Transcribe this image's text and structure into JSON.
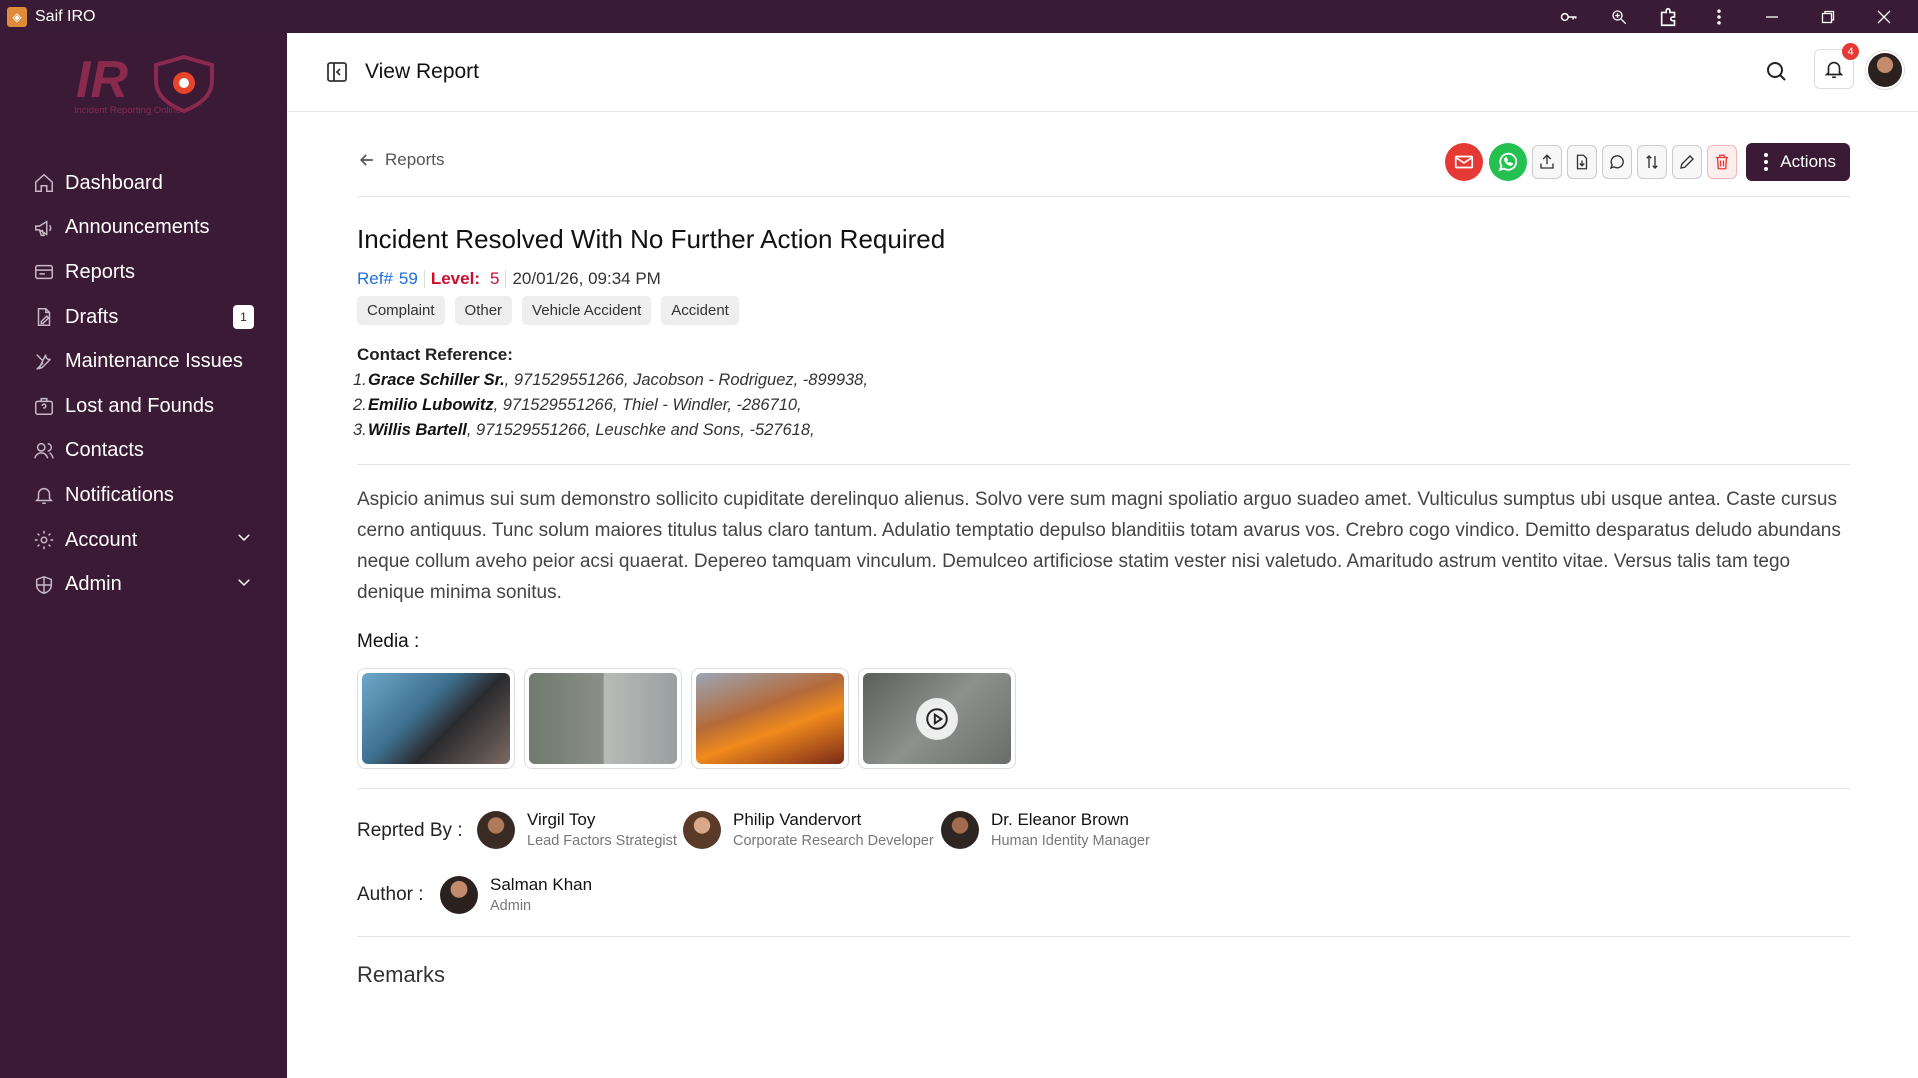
{
  "window": {
    "title": "Saif IRO",
    "icons": [
      "key-icon",
      "zoom-icon",
      "extension-icon",
      "more-vert-icon",
      "minimize-icon",
      "restore-icon",
      "close-icon"
    ]
  },
  "logo": {
    "text": "IR",
    "subtitle": "Incident Reporting Online"
  },
  "sidebar": {
    "items": [
      {
        "label": "Dashboard",
        "icon": "home-icon"
      },
      {
        "label": "Announcements",
        "icon": "megaphone-icon"
      },
      {
        "label": "Reports",
        "icon": "report-icon"
      },
      {
        "label": "Drafts",
        "icon": "draft-icon",
        "badge": "1"
      },
      {
        "label": "Maintenance Issues",
        "icon": "tools-icon"
      },
      {
        "label": "Lost and Founds",
        "icon": "lost-found-icon"
      },
      {
        "label": "Contacts",
        "icon": "contacts-icon"
      },
      {
        "label": "Notifications",
        "icon": "bell-icon"
      },
      {
        "label": "Account",
        "icon": "gear-icon",
        "expandable": true
      },
      {
        "label": "Admin",
        "icon": "shield-icon",
        "expandable": true
      }
    ]
  },
  "header": {
    "title": "View Report",
    "notification_count": "4"
  },
  "main": {
    "back_label": "Reports",
    "actions_label": "Actions",
    "title": "Incident Resolved With No Further Action Required",
    "ref_label": "Ref#",
    "ref": "59",
    "level_label": "Level:",
    "level": "5",
    "datetime": "20/01/26, 09:34 PM",
    "tags": [
      "Complaint",
      "Other",
      "Vehicle Accident",
      "Accident"
    ],
    "contact_heading": "Contact Reference:",
    "contacts": [
      {
        "num": "1.",
        "name": "Grace Schiller Sr.",
        "rest": ", 971529551266, Jacobson - Rodriguez, -899938,"
      },
      {
        "num": "2.",
        "name": "Emilio Lubowitz",
        "rest": ", 971529551266, Thiel - Windler, -286710,"
      },
      {
        "num": "3.",
        "name": "Willis Bartell",
        "rest": ", 971529551266, Leuschke and Sons, -527618,"
      }
    ],
    "description": "Aspicio animus sui sum demonstro sollicito cupiditate derelinquo alienus. Solvo vere sum magni spoliatio arguo suadeo amet. Vulticulus sumptus ubi usque antea. Caste cursus cerno antiquus. Tunc solum maiores titulus talus claro tantum. Adulatio temptatio depulso blanditiis totam avarus vos. Crebro cogo vindico. Demitto desparatus deludo abundans neque collum aveho peior acsi quaerat. Depereo tamquam vinculum. Demulceo artificiose statim vester nisi valetudo. Amaritudo astrum ventito vitae. Versus talis tam tego denique minima sonitus.",
    "media_label": "Media :",
    "reported_by_label": "Reprted By :",
    "reporters": [
      {
        "name": "Virgil Toy",
        "role": "Lead Factors Strategist"
      },
      {
        "name": "Philip Vandervort",
        "role": "Corporate Research Developer"
      },
      {
        "name": "Dr. Eleanor Brown",
        "role": "Human Identity Manager"
      }
    ],
    "author_label": "Author :",
    "author": {
      "name": "Salman Khan",
      "role": "Admin"
    },
    "remarks_label": "Remarks"
  }
}
